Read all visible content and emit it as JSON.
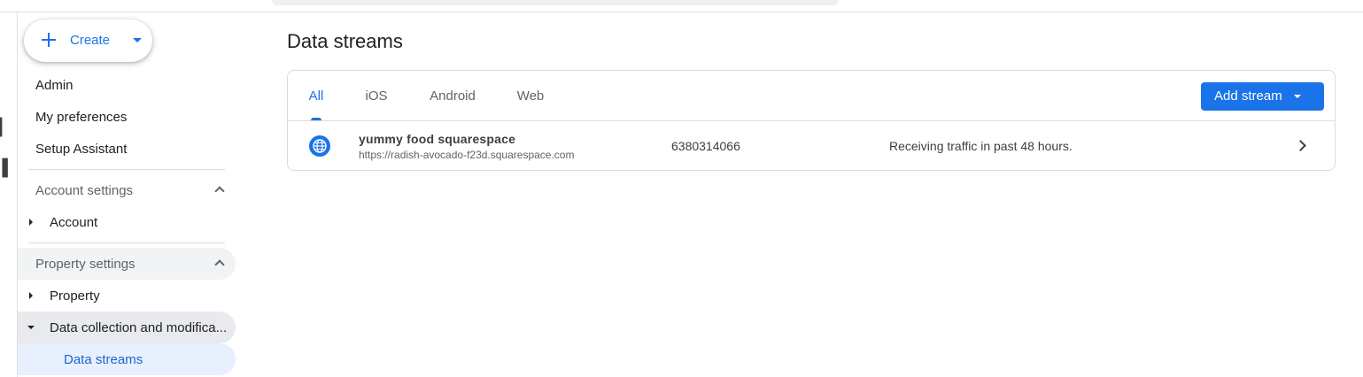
{
  "sidebar": {
    "create_label": "Create",
    "nav": [
      {
        "label": "Admin"
      },
      {
        "label": "My preferences"
      },
      {
        "label": "Setup Assistant"
      }
    ],
    "account_settings": {
      "label": "Account settings",
      "items": [
        {
          "label": "Account"
        }
      ]
    },
    "property_settings": {
      "label": "Property settings",
      "items": [
        {
          "label": "Property"
        },
        {
          "label": "Data collection and modifica..."
        }
      ],
      "sub_items": [
        {
          "label": "Data streams"
        }
      ]
    }
  },
  "main": {
    "title": "Data streams",
    "tabs": [
      {
        "label": "All",
        "active": true
      },
      {
        "label": "iOS"
      },
      {
        "label": "Android"
      },
      {
        "label": "Web"
      }
    ],
    "add_stream_label": "Add stream",
    "streams": [
      {
        "icon": "globe-icon",
        "name": "yummy food squarespace",
        "url": "https://radish-avocado-f23d.squarespace.com",
        "id": "6380314066",
        "status": "Receiving traffic in past 48 hours."
      }
    ]
  },
  "colors": {
    "accent": "#1a73e8",
    "selected_bg": "#e8f0fe",
    "divider": "#dadce0"
  }
}
